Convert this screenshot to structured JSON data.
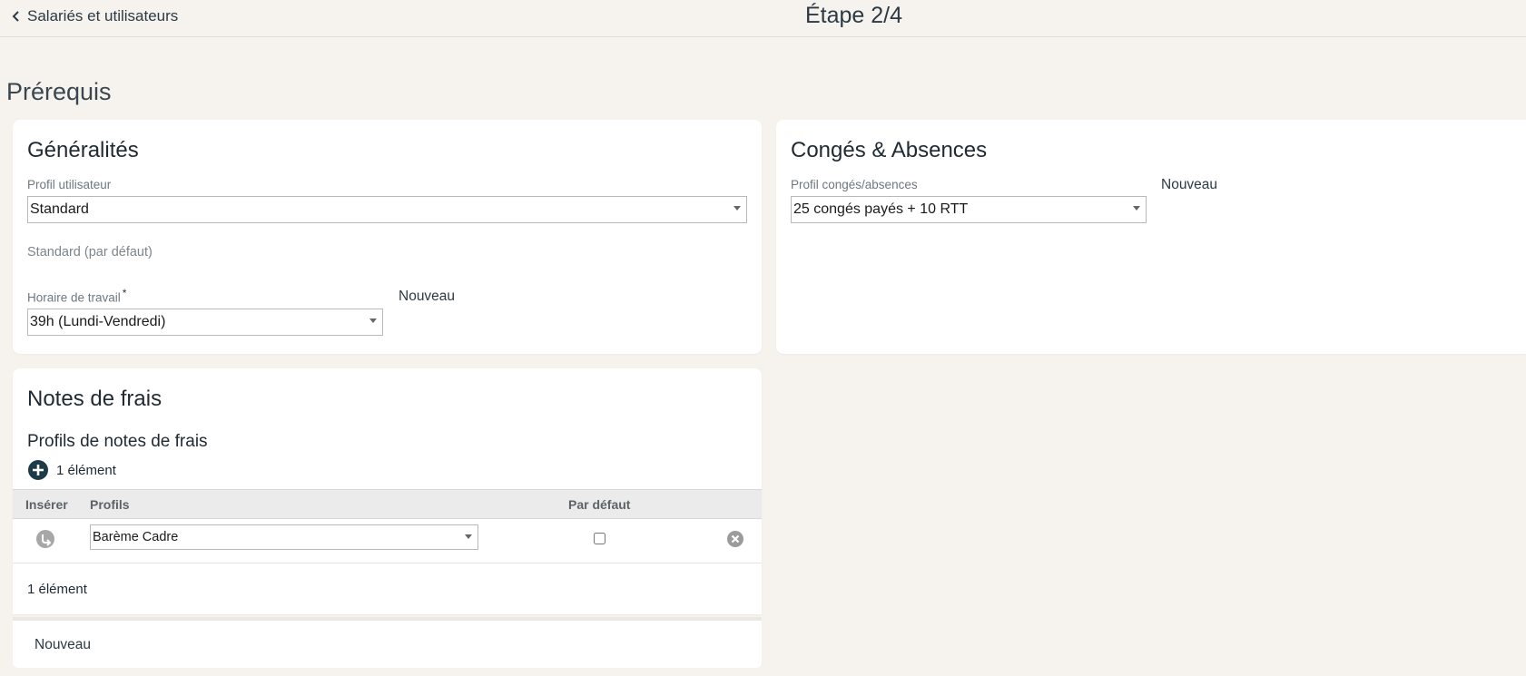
{
  "header": {
    "back_label": "Salariés et utilisateurs",
    "step": "Étape 2/4"
  },
  "page_title": "Prérequis",
  "generalites": {
    "title": "Généralités",
    "profile_label": "Profil utilisateur",
    "profile_value": "Standard",
    "profile_hint": "Standard (par défaut)",
    "schedule_label": "Horaire de travail",
    "required_mark": "*",
    "schedule_value": "39h (Lundi-Vendredi)",
    "schedule_new": "Nouveau"
  },
  "conges": {
    "title": "Congés & Absences",
    "profile_label": "Profil congés/absences",
    "profile_value": "25 congés payés + 10 RTT",
    "new_label": "Nouveau"
  },
  "notes": {
    "title": "Notes de frais",
    "subtitle": "Profils de notes de frais",
    "add_count": "1 élément",
    "columns": {
      "insert": "Insérer",
      "profiles": "Profils",
      "default": "Par défaut"
    },
    "rows": [
      {
        "profile": "Barème Cadre",
        "is_default": false
      }
    ],
    "footer_count": "1 élément",
    "new_label": "Nouveau"
  },
  "colors": {
    "background": "#f6f3ee",
    "card": "#ffffff",
    "accent_dark": "#1f3a48",
    "icon_gray": "#9b9b9b"
  }
}
